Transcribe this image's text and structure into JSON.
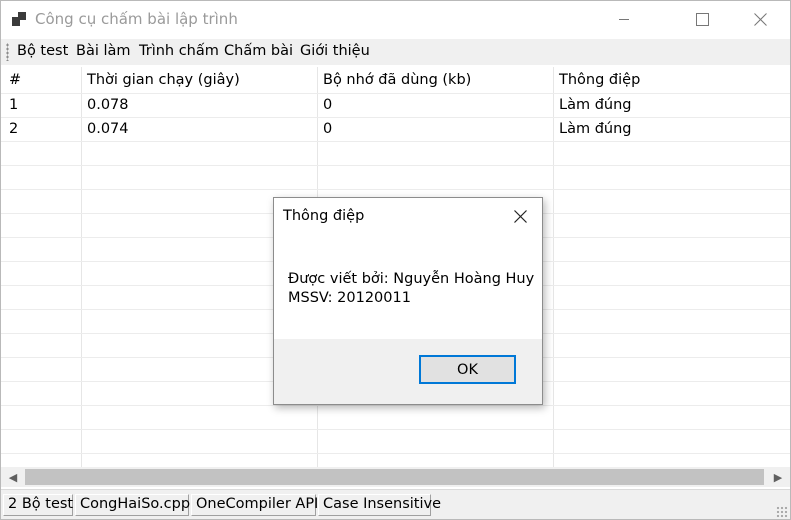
{
  "window": {
    "title": "Công cụ chấm bài lập trình",
    "minimize_icon": "minimize-icon",
    "maximize_icon": "maximize-icon",
    "close_icon": "close-icon"
  },
  "menu": {
    "items": [
      "Bộ test",
      "Bài làm",
      "Trình chấm",
      "Chấm bài",
      "Giới thiệu"
    ]
  },
  "grid": {
    "columns": [
      "#",
      "Thời gian chạy (giây)",
      "Bộ nhớ đã dùng (kb)",
      "Thông điệp"
    ],
    "rows": [
      [
        "1",
        "0.078",
        "0",
        "Làm đúng"
      ],
      [
        "2",
        "0.074",
        "0",
        "Làm đúng"
      ]
    ]
  },
  "status": {
    "panels": [
      "2 Bộ test",
      "CongHaiSo.cpp",
      "OneCompiler API",
      "Case Insensitive"
    ]
  },
  "dialog": {
    "title": "Thông điệp",
    "lines": [
      "Được viết bởi: Nguyễn Hoàng Huy",
      "MSSV: 20120011"
    ],
    "ok_label": "OK"
  },
  "colors": {
    "focus_border": "#0078d7",
    "menubar_bg": "#f0f0f0",
    "title_text": "#9a9a9a"
  }
}
